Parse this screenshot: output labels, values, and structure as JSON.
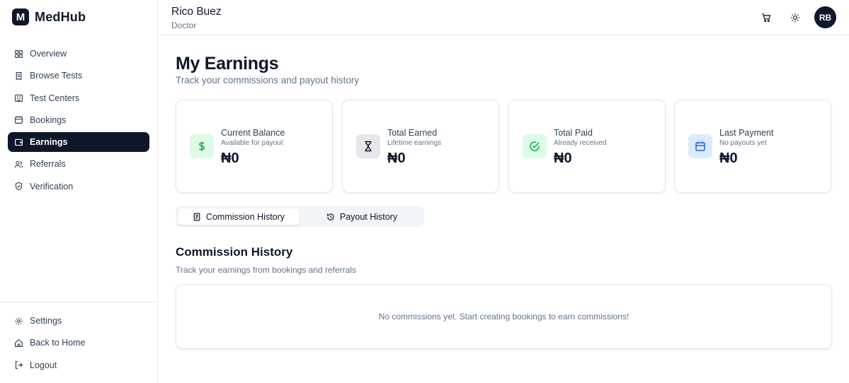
{
  "brand": {
    "logo_letter": "M",
    "name": "MedHub"
  },
  "sidebar": {
    "items": [
      {
        "label": "Overview",
        "icon": "grid-icon"
      },
      {
        "label": "Browse Tests",
        "icon": "receipt-icon"
      },
      {
        "label": "Test Centers",
        "icon": "building-icon"
      },
      {
        "label": "Bookings",
        "icon": "calendar-icon"
      },
      {
        "label": "Earnings",
        "icon": "wallet-icon",
        "active": true
      },
      {
        "label": "Referrals",
        "icon": "users-icon"
      },
      {
        "label": "Verification",
        "icon": "shield-icon"
      }
    ],
    "bottom_items": [
      {
        "label": "Settings",
        "icon": "gear-icon"
      },
      {
        "label": "Back to Home",
        "icon": "home-icon"
      },
      {
        "label": "Logout",
        "icon": "logout-icon"
      }
    ]
  },
  "header": {
    "user_name": "Rico Buez",
    "user_role": "Doctor",
    "avatar_initials": "RB",
    "icons": [
      "cart-icon",
      "sun-icon"
    ]
  },
  "page": {
    "title": "My Earnings",
    "subtitle": "Track your commissions and payout history"
  },
  "stats": [
    {
      "label": "Current Balance",
      "sub": "Available for payout",
      "value": "₦0",
      "icon": "dollar-icon",
      "icon_bg": "#dcfce7",
      "icon_color": "#16a34a"
    },
    {
      "label": "Total Earned",
      "sub": "Lifetime earnings",
      "value": "₦0",
      "icon": "hourglass-icon",
      "icon_bg": "#e5e7eb",
      "icon_color": "#0f172a"
    },
    {
      "label": "Total Paid",
      "sub": "Already received",
      "value": "₦0",
      "icon": "check-circle-icon",
      "icon_bg": "#dcfce7",
      "icon_color": "#16a34a"
    },
    {
      "label": "Last Payment",
      "sub": "No payouts yet",
      "value": "₦0",
      "icon": "calendar-icon",
      "icon_bg": "#dbeafe",
      "icon_color": "#2563eb"
    }
  ],
  "tabs": [
    {
      "label": "Commission History",
      "icon": "document-icon",
      "active": true
    },
    {
      "label": "Payout History",
      "icon": "history-icon",
      "active": false
    }
  ],
  "commission_section": {
    "title": "Commission History",
    "subtitle": "Track your earnings from bookings and referrals",
    "empty_message": "No commissions yet. Start creating bookings to earn commissions!"
  },
  "colors": {
    "primary": "#0f172a",
    "muted_text": "#64748b",
    "border": "#e5e7eb",
    "success": "#16a34a",
    "info": "#2563eb"
  }
}
